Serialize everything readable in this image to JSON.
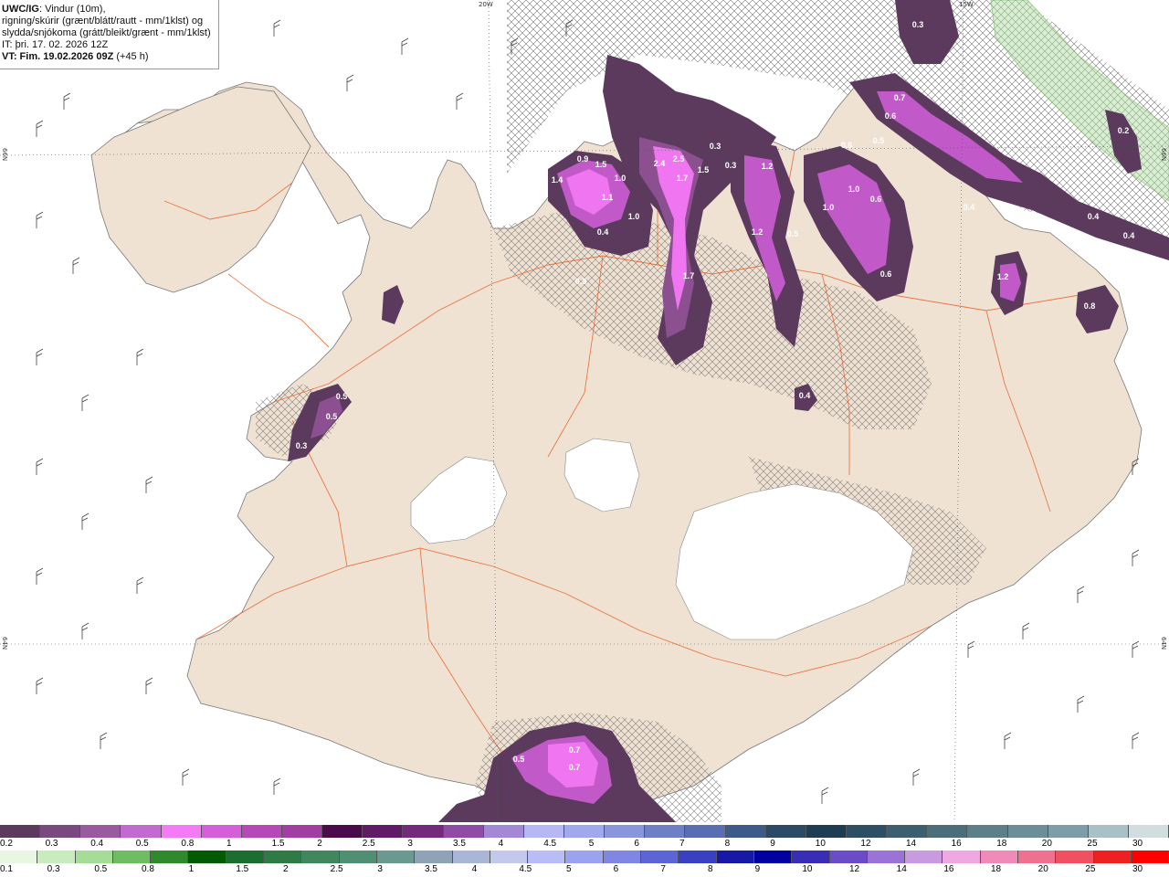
{
  "header": {
    "line1_bold": "UWC/IG",
    "line1_rest": ": Vindur (10m),",
    "line2": "rigning/skúrir (grænt/blátt/rautt - mm/1klst) og",
    "line3": "slydda/snjókoma (grátt/bleikt/grænt - mm/1klst)",
    "line4": "IT: þri. 17. 02. 2026 12Z",
    "line5_bold": "VT: Fim. 19.02.2026 09Z",
    "line5_rest": " (+45 h)"
  },
  "grid_labels": {
    "top_left": "20W",
    "top_right": "15W",
    "left_upper": "66N",
    "left_lower": "64N",
    "right_upper": "66N",
    "right_lower": "64N"
  },
  "colors": {
    "land": "#efe2d3",
    "sea": "#ffffff",
    "roads": "#e8642b",
    "snow_dark": "#5b3a5e",
    "snow_mid": "#8c4f90",
    "snow_light": "#c259c9",
    "snow_bright": "#f075f0",
    "rain_green": "#d7f0cf"
  },
  "precip_labels": [
    {
      "text": "0.3"
    },
    {
      "text": "0.7"
    },
    {
      "text": "0.6"
    },
    {
      "text": "0.5"
    },
    {
      "text": "0.2"
    },
    {
      "text": "0.6"
    },
    {
      "text": "0.3"
    },
    {
      "text": "2.4"
    },
    {
      "text": "2.5"
    },
    {
      "text": "1.5"
    },
    {
      "text": "0.3"
    },
    {
      "text": "1.2"
    },
    {
      "text": "1.5"
    },
    {
      "text": "1.0"
    },
    {
      "text": "1.4"
    },
    {
      "text": "0.9"
    },
    {
      "text": "1.1"
    },
    {
      "text": "1.7"
    },
    {
      "text": "1.0"
    },
    {
      "text": "0.4"
    },
    {
      "text": "1.0"
    },
    {
      "text": "1.2"
    },
    {
      "text": "0.5"
    },
    {
      "text": "1.7"
    },
    {
      "text": "0.3"
    },
    {
      "text": "0.4"
    },
    {
      "text": "0.4"
    },
    {
      "text": "0.4"
    },
    {
      "text": "1.2"
    },
    {
      "text": "0.6"
    },
    {
      "text": "0.5"
    },
    {
      "text": "0.5"
    },
    {
      "text": "0.3"
    },
    {
      "text": "0.4"
    },
    {
      "text": "0.5"
    },
    {
      "text": "0.7"
    },
    {
      "text": "0.7"
    },
    {
      "text": "1.0"
    },
    {
      "text": "0.6"
    },
    {
      "text": "0.8"
    }
  ],
  "legend_snow": {
    "colors": [
      "#5b3a5e",
      "#7a4a7e",
      "#9a5aa0",
      "#c36ad0",
      "#f37bf5",
      "#d55fd8",
      "#b649b8",
      "#a03ea4",
      "#4a0a4c",
      "#611a66",
      "#742a7c",
      "#8f4ba5",
      "#a488d8",
      "#b5b8f5",
      "#a0a8ee",
      "#8a96dc",
      "#6f7fc5",
      "#5a6db2",
      "#3d5a8a",
      "#2a4a66",
      "#1f3d52",
      "#2e4f63",
      "#3b5f6f",
      "#4a6e7a",
      "#5c7f88",
      "#6c8e96",
      "#7d9ea6",
      "#a9c0c7",
      "#d2dde0"
    ],
    "labels": [
      "0.2",
      "0.3",
      "0.4",
      "0.5",
      "0.8",
      "1",
      "1.5",
      "2",
      "2.5",
      "3",
      "3.5",
      "4",
      "4.5",
      "5",
      "6",
      "7",
      "8",
      "9",
      "10",
      "12",
      "14",
      "16",
      "18",
      "20",
      "25",
      "30"
    ]
  },
  "legend_rain": {
    "colors": [
      "#e8f7e2",
      "#c9ecbf",
      "#a5dc98",
      "#6fbd62",
      "#2f8a2d",
      "#005a00",
      "#1c6e2e",
      "#2f7b46",
      "#40875d",
      "#518f74",
      "#6a9a8f",
      "#8ea3b7",
      "#a9b6d7",
      "#c2c9ec",
      "#b8bdf5",
      "#9ba2f0",
      "#7f86e4",
      "#5c65d6",
      "#3a40c2",
      "#1818a8",
      "#0000a0",
      "#3a2db5",
      "#6a4bc8",
      "#9b72d6",
      "#c99ae0",
      "#f0a8e3",
      "#f08ab8",
      "#f07090",
      "#f05060",
      "#f02020",
      "#ff0000"
    ],
    "labels": [
      "0.1",
      "0.3",
      "0.5",
      "0.8",
      "1",
      "1.5",
      "2",
      "2.5",
      "3",
      "3.5",
      "4",
      "4.5",
      "5",
      "6",
      "7",
      "8",
      "9",
      "10",
      "12",
      "14",
      "16",
      "18",
      "20",
      "25",
      "30"
    ]
  }
}
